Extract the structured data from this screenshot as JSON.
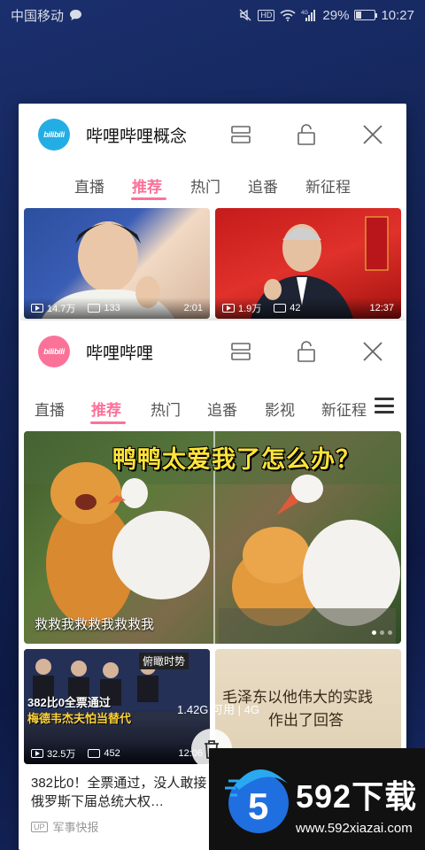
{
  "status_bar": {
    "carrier": "中国移动",
    "network_type": "4G",
    "battery": "29%",
    "battery_level": 0.29,
    "time": "10:27",
    "icons": [
      "chat-bubble-icon",
      "mute-icon",
      "hd-icon",
      "wifi-icon",
      "signal-icon",
      "battery-icon"
    ]
  },
  "back_card": {
    "app_title": "哔哩哔哩概念",
    "logo_text": "bilibili",
    "tabs": [
      "直播",
      "推荐",
      "热门",
      "追番",
      "新征程"
    ],
    "active_tab": "推荐",
    "videos": [
      {
        "views": "14.7万",
        "comments": "133",
        "duration": "2:01"
      },
      {
        "views": "1.9万",
        "comments": "42",
        "duration": "12:37"
      }
    ]
  },
  "front_card": {
    "app_title": "哔哩哔哩",
    "logo_text": "bilibili",
    "tabs": [
      "直播",
      "推荐",
      "热门",
      "追番",
      "影视",
      "新征程"
    ],
    "active_tab": "推荐",
    "banner": {
      "title": "鸭鸭太爱我了怎么办？",
      "caption": "救救我救救我救救我",
      "dots": 3,
      "active_dot": 0
    },
    "video_cards": [
      {
        "thumb_text_line1": "382比0全票通过",
        "thumb_text_line2": "梅德韦杰夫怕当替代",
        "thumb_badge": "俯瞰时势",
        "views": "32.5万",
        "comments": "452",
        "duration": "12:06",
        "title": "382比0！全票通过，没人敢接俄罗斯下届总统大权…",
        "up_badge": "UP",
        "up_name": "军事快报"
      },
      {
        "thumb_text_line1": "毛泽东以他伟大的实践",
        "thumb_text_line2": "作出了回答"
      }
    ]
  },
  "recents": {
    "memory_text": "1.42G 可用 | 4G",
    "clear_icon": "trash-icon"
  },
  "navigation": {
    "back_icon": "back-triangle-icon",
    "home_icon": "home-circle-icon"
  },
  "watermark": {
    "brand": "592下载",
    "url": "www.592xiazai.com"
  },
  "colors": {
    "brand_pink": "#fb7299",
    "brand_blue": "#23ade5",
    "banner_title": "#ffe33a"
  }
}
